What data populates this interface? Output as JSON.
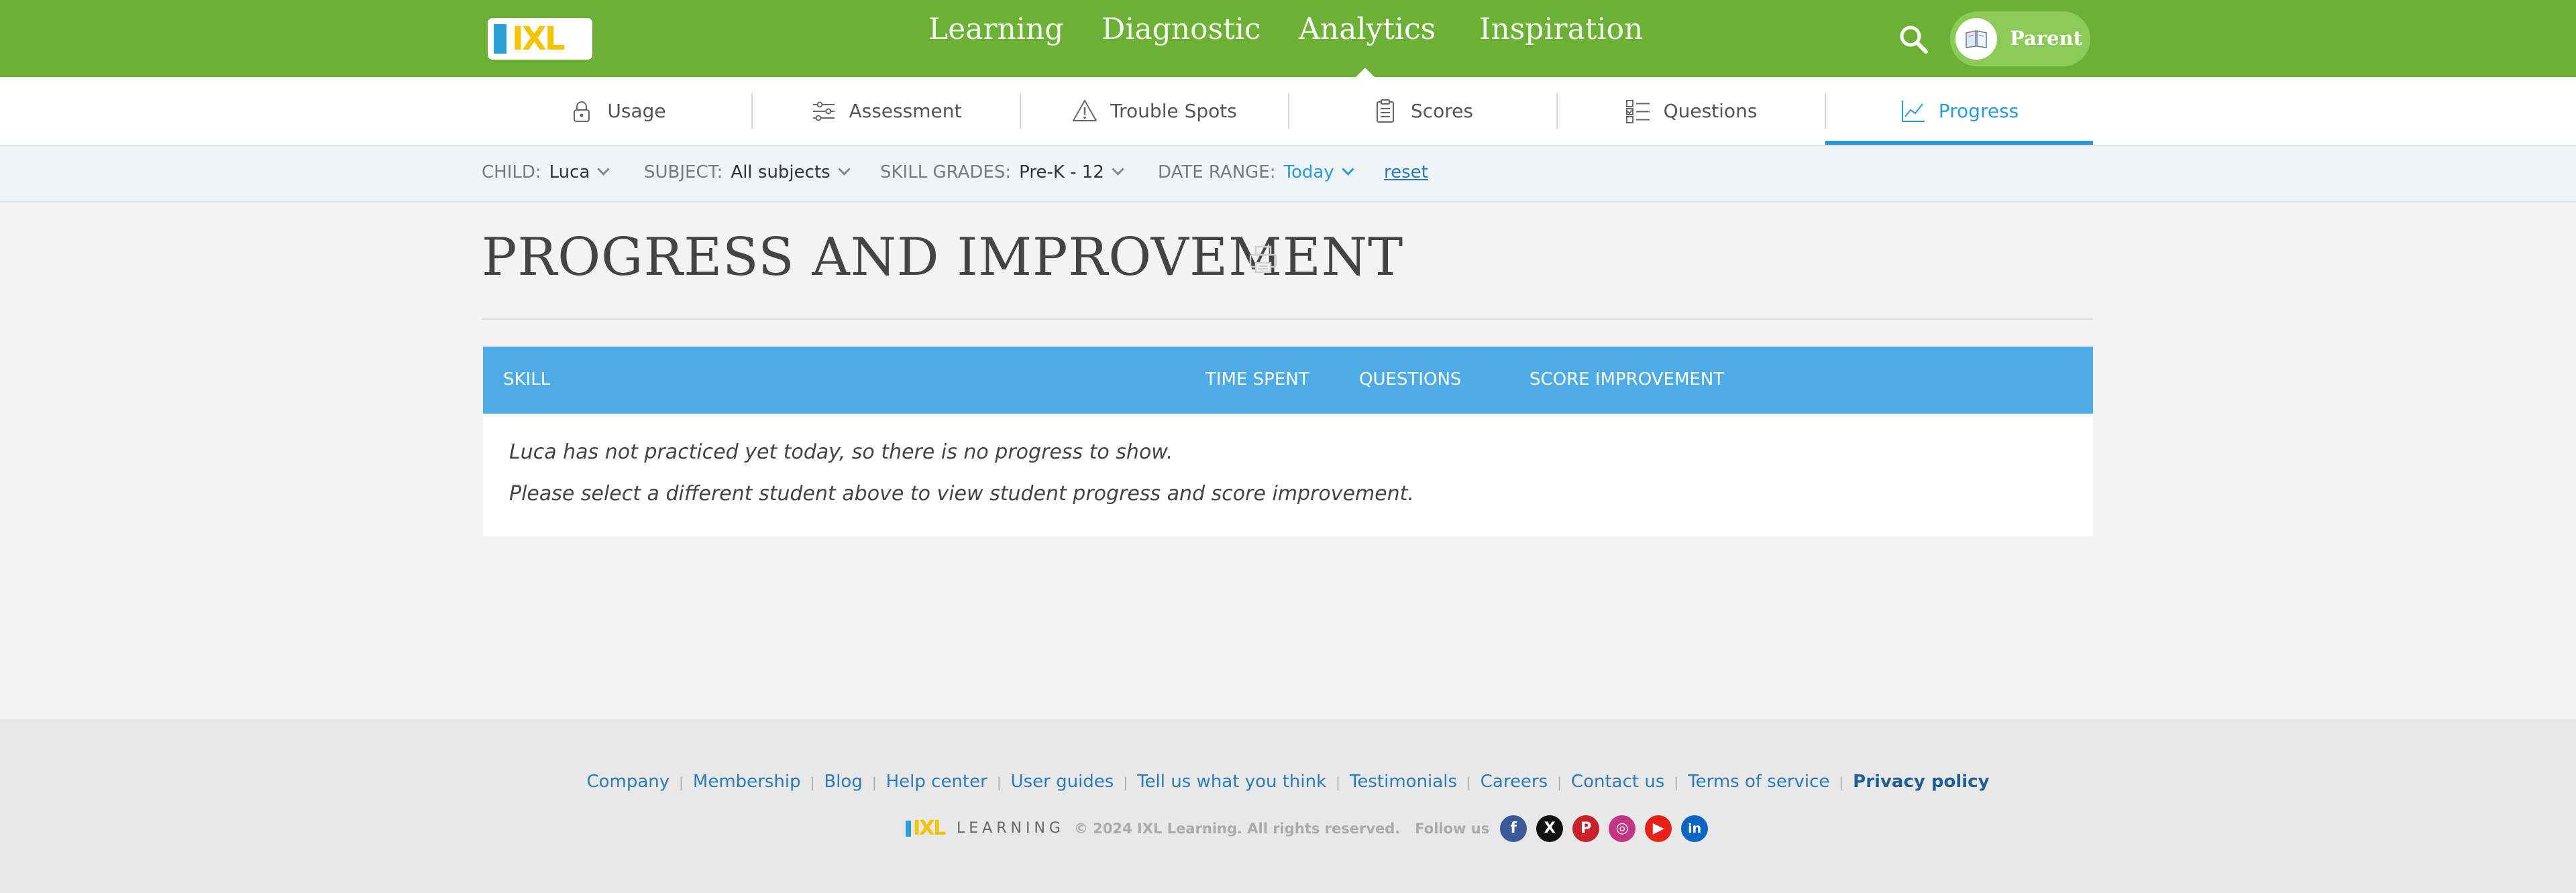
{
  "nav": {
    "logo_text": "IXL",
    "links": [
      "Learning",
      "Diagnostic",
      "Analytics",
      "Inspiration"
    ],
    "active": "Analytics",
    "user_label": "Parent",
    "icons": {
      "search": "search-icon",
      "avatar": "book-avatar-icon"
    }
  },
  "subnav": {
    "tabs": [
      {
        "label": "Usage",
        "icon": "lock-icon"
      },
      {
        "label": "Assessment",
        "icon": "sliders-icon"
      },
      {
        "label": "Trouble Spots",
        "icon": "warning-icon"
      },
      {
        "label": "Scores",
        "icon": "clipboard-icon"
      },
      {
        "label": "Questions",
        "icon": "checklist-icon"
      },
      {
        "label": "Progress",
        "icon": "line-chart-icon"
      }
    ],
    "active": "Progress"
  },
  "filters": {
    "child": {
      "label": "CHILD:",
      "value": "Luca"
    },
    "subject": {
      "label": "SUBJECT:",
      "value": "All subjects"
    },
    "skill_grades": {
      "label": "SKILL GRADES:",
      "value": "Pre-K - 12"
    },
    "date_range": {
      "label": "DATE RANGE:",
      "value": "Today"
    },
    "reset": "reset"
  },
  "main": {
    "title": "PROGRESS AND IMPROVEMENT",
    "table": {
      "columns": [
        "SKILL",
        "TIME SPENT",
        "QUESTIONS",
        "SCORE IMPROVEMENT"
      ],
      "empty_line1": "Luca has not practiced yet today, so there is no progress to show.",
      "empty_line2": "Please select a different student above to view student progress and score improvement."
    }
  },
  "footer": {
    "links": [
      "Company",
      "Membership",
      "Blog",
      "Help center",
      "User guides",
      "Tell us what you think",
      "Testimonials",
      "Careers",
      "Contact us",
      "Terms of service",
      "Privacy policy"
    ],
    "brand": "IXL",
    "brand_sub": "LEARNING",
    "copyright": "© 2024 IXL Learning. All rights reserved.",
    "follow": "Follow us",
    "social": [
      "facebook-icon",
      "x-icon",
      "pinterest-icon",
      "instagram-icon",
      "youtube-icon",
      "linkedin-icon"
    ],
    "social_letters": [
      "f",
      "X",
      "P",
      "◎",
      "▶",
      "in"
    ]
  },
  "colors": {
    "nav_green": "#6cb136",
    "accent_blue": "#2a9bd8",
    "table_header": "#4eabe6",
    "social": [
      "#3b5998",
      "#111111",
      "#c8232c",
      "#c13584",
      "#e62117",
      "#0a66c2"
    ]
  }
}
